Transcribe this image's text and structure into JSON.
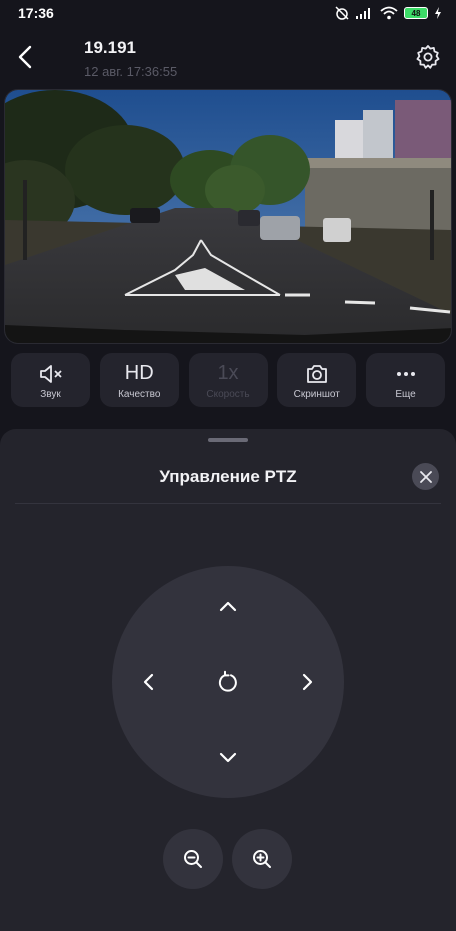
{
  "status_bar": {
    "time": "17:36",
    "battery": "48"
  },
  "header": {
    "camera_name": "19.191",
    "timestamp": "12 авг. 17:36:55",
    "back_icon": "chevron-left-icon",
    "settings_icon": "gear-icon"
  },
  "toolbar": {
    "items": [
      {
        "label": "Звук",
        "icon": "speaker-muted-icon",
        "enabled": true
      },
      {
        "label": "Качество",
        "icon_text": "HD",
        "enabled": true
      },
      {
        "label": "Скорость",
        "icon_text": "1x",
        "enabled": false
      },
      {
        "label": "Скриншот",
        "icon": "camera-icon",
        "enabled": true
      },
      {
        "label": "Еще",
        "icon": "more-dots-icon",
        "enabled": true
      }
    ]
  },
  "ptz_sheet": {
    "title": "Управление PTZ",
    "close_icon": "close-icon",
    "controls": [
      "up",
      "down",
      "left",
      "right",
      "reset",
      "zoom-out",
      "zoom-in"
    ]
  },
  "colors": {
    "background": "#15151c",
    "sheet": "#24242c",
    "joystick": "#33333d",
    "tool": "#24242d"
  }
}
